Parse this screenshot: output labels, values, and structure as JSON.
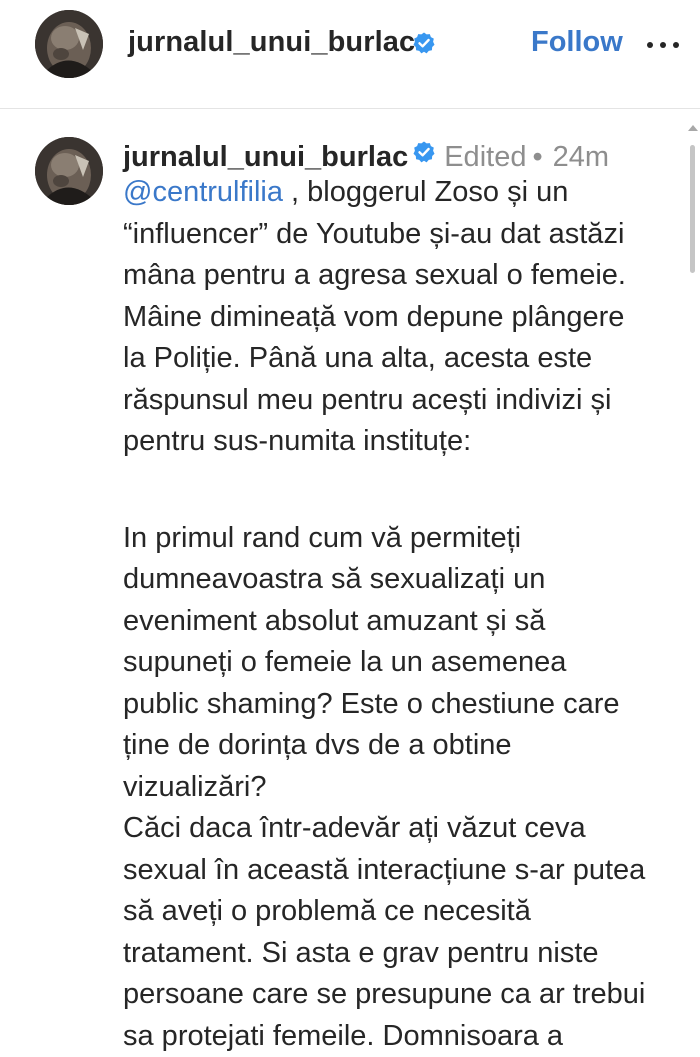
{
  "header": {
    "username": "jurnalul_unui_burlac",
    "follow_label": "Follow",
    "more_label": "•••"
  },
  "comment": {
    "username": "jurnalul_unui_burlac",
    "edited": "Edited",
    "separator": "•",
    "time": "24m",
    "mention": "@centrulfilia",
    "lines": [
      " , bloggerul Zoso și un",
      "“influencer” de Youtube și-au dat astăzi",
      "mâna pentru a agresa sexual o femeie.",
      "Mâine dimineață vom depune plângere",
      "la Poliție. Până una alta, acesta este",
      "răspunsul meu pentru acești indivizi și",
      "pentru sus-numita instituțe:",
      "",
      "In primul rand cum vă permiteți",
      "dumneavoastra să sexualizați un",
      "eveniment absolut amuzant și să",
      "supuneți o femeie la un asemenea",
      "public shaming? Este o chestiune care",
      "ține de dorința dvs de a obtine",
      "vizualizări?",
      "Căci daca într-adevăr ați văzut ceva",
      "sexual în această interacțiune s-ar putea",
      "să aveți o problemă ce necesită",
      "tratament. Si asta e grav pentru niste",
      "persoane care se presupune ca ar trebui",
      "sa protejati femeile. Domnisoara a"
    ]
  },
  "colors": {
    "link": "#3a78c9",
    "verified": "#3897f0",
    "text": "#262626",
    "muted": "#8e8e8e"
  },
  "icons": {
    "verified": "verified-badge-icon",
    "more": "more-options-icon"
  }
}
